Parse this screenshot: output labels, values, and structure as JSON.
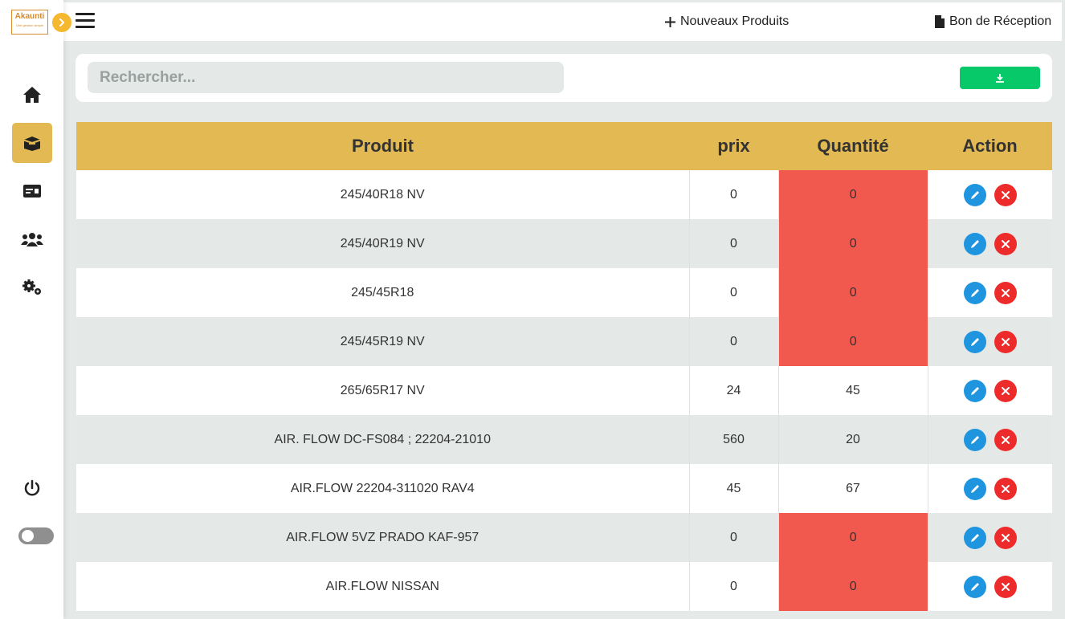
{
  "logo": {
    "text": "Akaunti",
    "tagline": "Une gestion simple"
  },
  "sidebar": {
    "items": [
      {
        "name": "home-icon",
        "active": false
      },
      {
        "name": "box-icon",
        "active": true
      },
      {
        "name": "id-card-icon",
        "active": false
      },
      {
        "name": "users-icon",
        "active": false
      },
      {
        "name": "cogs-icon",
        "active": false
      }
    ]
  },
  "header": {
    "new_products_label": "Nouveaux Produits",
    "receipt_label": "Bon de Réception"
  },
  "search": {
    "placeholder": "Rechercher..."
  },
  "table": {
    "columns": [
      "Produit",
      "prix",
      "Quantité",
      "Action"
    ],
    "rows": [
      {
        "produit": "245/40R18 NV",
        "prix": "0",
        "quantite": "0"
      },
      {
        "produit": "245/40R19 NV",
        "prix": "0",
        "quantite": "0"
      },
      {
        "produit": "245/45R18",
        "prix": "0",
        "quantite": "0"
      },
      {
        "produit": "245/45R19 NV",
        "prix": "0",
        "quantite": "0"
      },
      {
        "produit": "265/65R17 NV",
        "prix": "24",
        "quantite": "45"
      },
      {
        "produit": "AIR. FLOW DC-FS084 ; 22204-21010",
        "prix": "560",
        "quantite": "20"
      },
      {
        "produit": "AIR.FLOW 22204-311020 RAV4",
        "prix": "45",
        "quantite": "67"
      },
      {
        "produit": "AIR.FLOW 5VZ PRADO KAF-957",
        "prix": "0",
        "quantite": "0"
      },
      {
        "produit": "AIR.FLOW NISSAN",
        "prix": "0",
        "quantite": "0"
      }
    ]
  },
  "colors": {
    "accent": "#e2b952",
    "zero_stock": "#f1584e",
    "edit": "#1e95de",
    "delete": "#ee2b2b",
    "download": "#08c96a"
  }
}
